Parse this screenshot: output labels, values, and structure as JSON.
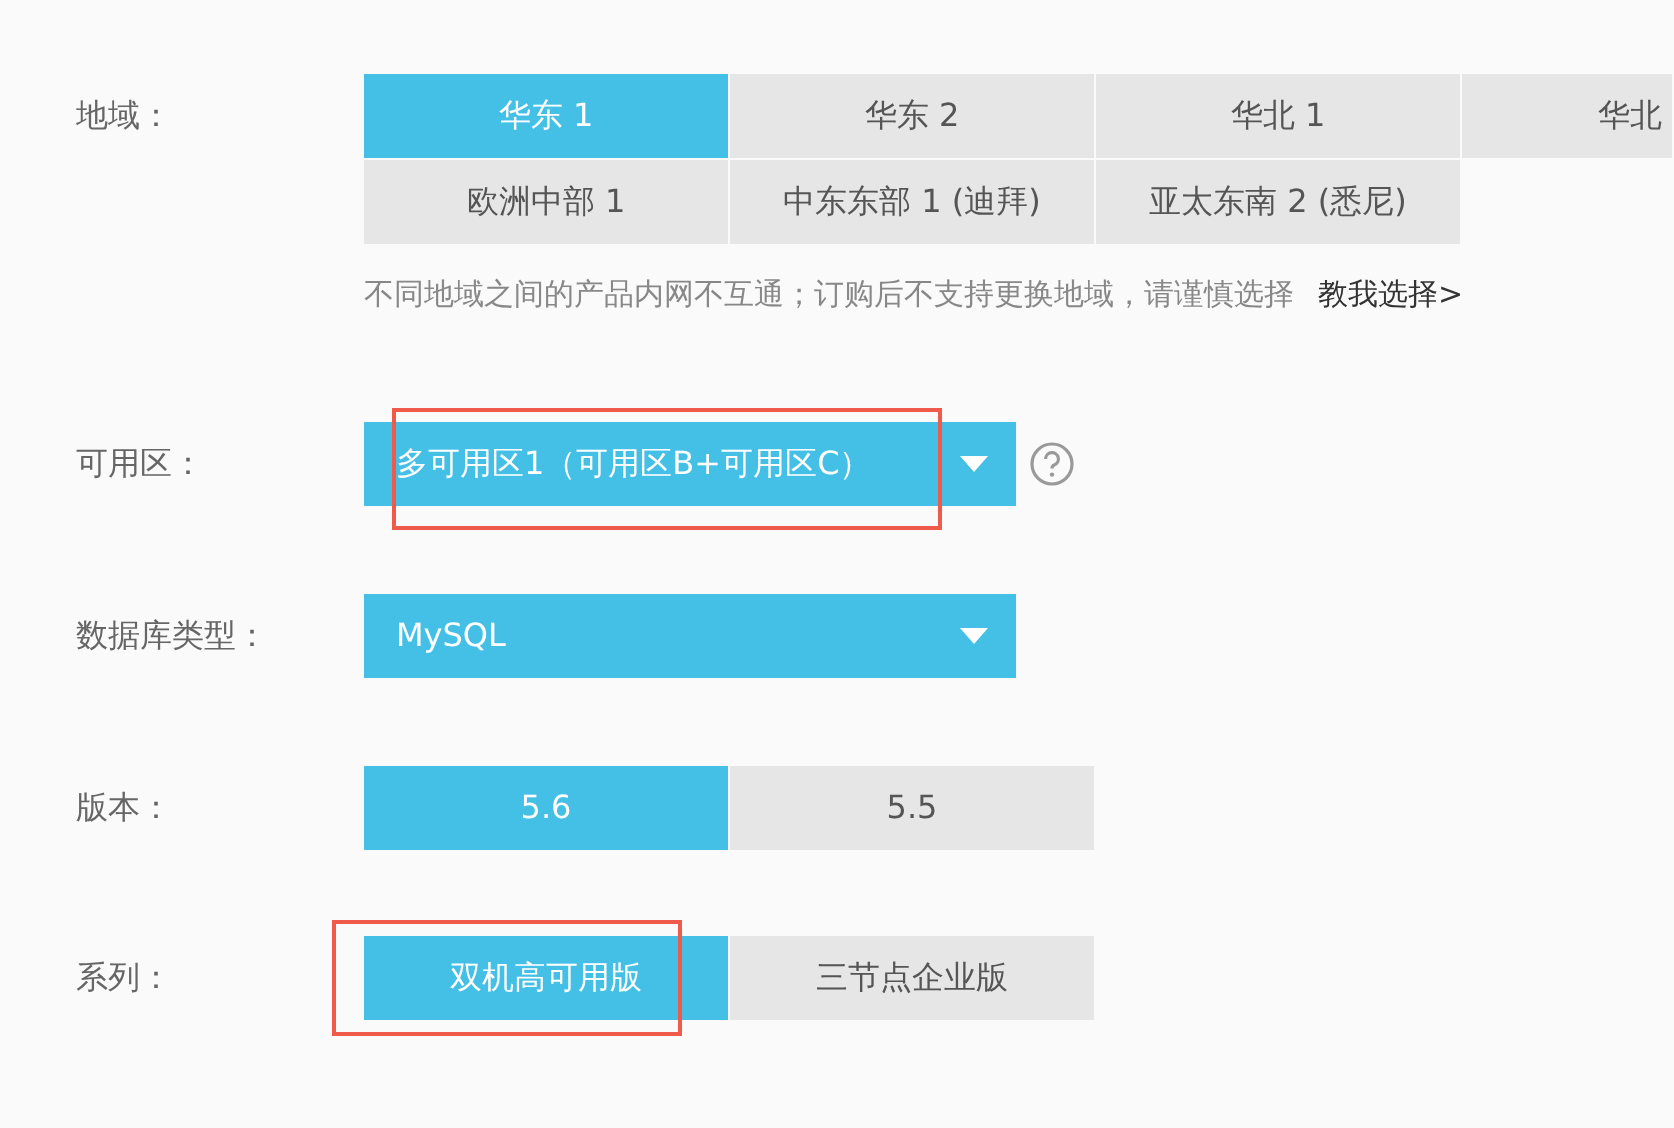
{
  "region": {
    "label": "地域：",
    "options": [
      {
        "text": "华东 1",
        "selected": true
      },
      {
        "text": "华东 2",
        "selected": false
      },
      {
        "text": "华北 1",
        "selected": false
      },
      {
        "text": "华北",
        "selected": false
      },
      {
        "text": "欧洲中部 1",
        "selected": false
      },
      {
        "text": "中东东部 1 (迪拜)",
        "selected": false
      },
      {
        "text": "亚太东南 2 (悉尼)",
        "selected": false
      }
    ],
    "note": "不同地域之间的产品内网不互通；订购后不支持更换地域，请谨慎选择",
    "help_link": "教我选择>"
  },
  "zone": {
    "label": "可用区：",
    "value": "多可用区1（可用区B+可用区C）",
    "highlighted": true
  },
  "db_type": {
    "label": "数据库类型：",
    "value": "MySQL"
  },
  "version": {
    "label": "版本：",
    "options": [
      {
        "text": "5.6",
        "selected": true
      },
      {
        "text": "5.5",
        "selected": false
      }
    ]
  },
  "series": {
    "label": "系列：",
    "options": [
      {
        "text": "双机高可用版",
        "selected": true,
        "highlighted": true
      },
      {
        "text": "三节点企业版",
        "selected": false,
        "highlighted": false
      }
    ]
  }
}
